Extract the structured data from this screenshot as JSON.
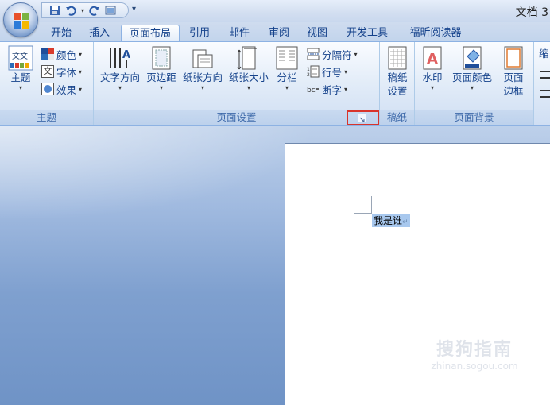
{
  "window": {
    "title": "文档 3"
  },
  "tabs": [
    "开始",
    "插入",
    "页面布局",
    "引用",
    "邮件",
    "审阅",
    "视图",
    "开发工具",
    "福昕阅读器"
  ],
  "active_tab": "页面布局",
  "ribbon": {
    "theme": {
      "label": "主题",
      "themes_label": "主题",
      "colors_label": "颜色",
      "fonts_label": "字体",
      "effects_label": "效果"
    },
    "page_setup": {
      "label": "页面设置",
      "text_direction": "文字方向",
      "margins": "页边距",
      "orientation": "纸张方向",
      "size": "纸张大小",
      "columns": "分栏",
      "breaks": "分隔符",
      "line_numbers": "行号",
      "hyphenation": "断字"
    },
    "manuscript": {
      "label": "稿纸",
      "settings_line1": "稿纸",
      "settings_line2": "设置"
    },
    "page_background": {
      "label": "页面背景",
      "watermark": "水印",
      "page_color": "页面颜色",
      "borders_line1": "页面",
      "borders_line2": "边框"
    },
    "paragraph": {
      "partial_label": "缩"
    }
  },
  "document": {
    "text": "我是谁"
  },
  "watermark": {
    "main": "搜狗指南",
    "sub": "zhinan.sogou.com"
  },
  "colors": {
    "highlight": "#d9342b",
    "selection": "#a8c8ee",
    "ribbon_text": "#15428b"
  }
}
